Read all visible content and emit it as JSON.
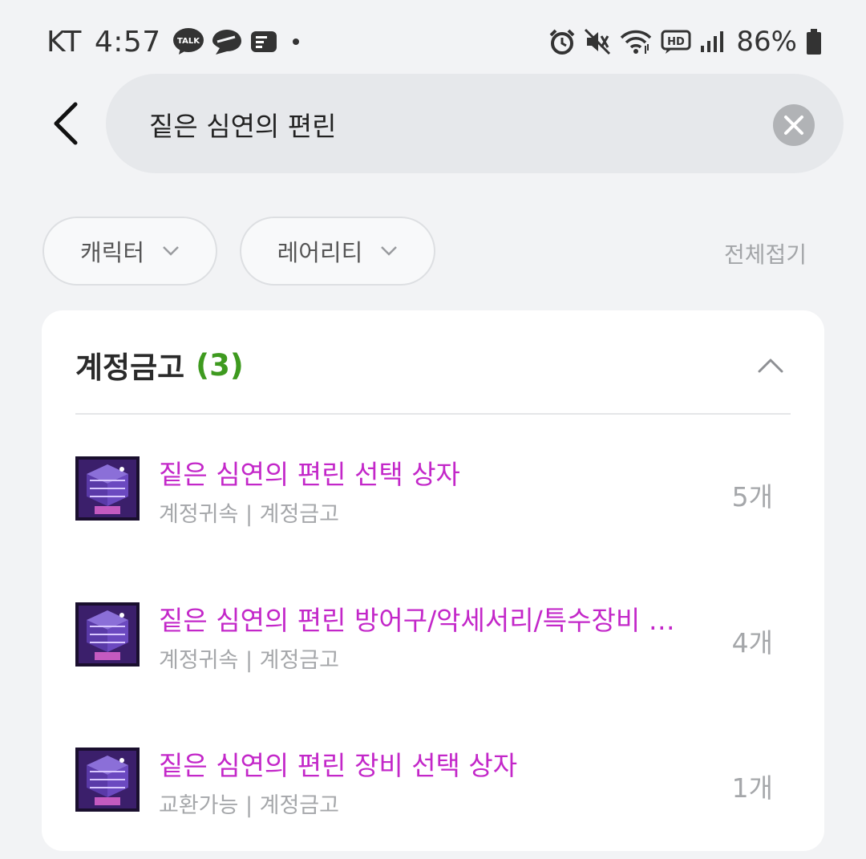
{
  "status_bar": {
    "carrier": "KT",
    "time": "4:57",
    "talk_icon_text": "TALK",
    "battery": "86%"
  },
  "search": {
    "value": "짙은 심연의 편린",
    "placeholder": ""
  },
  "filters": {
    "character_label": "캐릭터",
    "rarity_label": "레어리티",
    "collapse_all": "전체접기"
  },
  "section": {
    "title": "계정금고",
    "count": "(3)",
    "items": [
      {
        "name": "짙은 심연의 편린 선택 상자",
        "meta": "계정귀속 | 계정금고",
        "qty": "5개"
      },
      {
        "name": "짙은 심연의 편린 방어구/악세서리/특수장비 선...",
        "meta": "계정귀속 | 계정금고",
        "qty": "4개"
      },
      {
        "name": "짙은 심연의 편린 장비 선택 상자",
        "meta": "교환가능 | 계정금고",
        "qty": "1개"
      }
    ]
  },
  "colors": {
    "item_name": "#c327c9",
    "count_green": "#3e9a1f",
    "background": "#f2f3f5",
    "card": "#ffffff"
  },
  "icons": [
    "talk-icon",
    "chat-bubble-icon",
    "news-icon",
    "alarm-icon",
    "mute-icon",
    "wifi-icon",
    "hd-icon",
    "signal-icon",
    "battery-icon",
    "back-arrow-icon",
    "clear-icon",
    "chevron-down-icon",
    "chevron-up-icon",
    "item-box-icon"
  ]
}
